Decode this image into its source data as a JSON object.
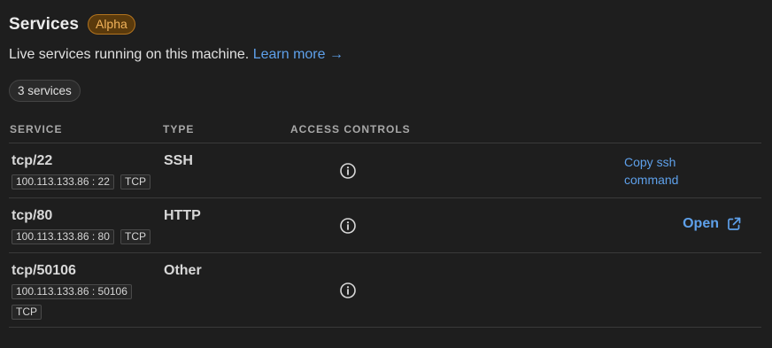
{
  "header": {
    "title": "Services",
    "badge": "Alpha",
    "subtitle": "Live services running on this machine.",
    "learn_more": "Learn more →",
    "count": "3 services"
  },
  "table": {
    "columns": [
      "SERVICE",
      "TYPE",
      "ACCESS CONTROLS"
    ],
    "rows": [
      {
        "service": "tcp/22",
        "type": "SSH",
        "address": "100.113.133.86 : 22",
        "protocol": "TCP",
        "action": "Copy ssh command",
        "action_line1": "Copy ssh",
        "action_line2": "command"
      },
      {
        "service": "tcp/80",
        "type": "HTTP",
        "address": "100.113.133.86 : 80",
        "protocol": "TCP",
        "action": "Open"
      },
      {
        "service": "tcp/50106",
        "type": "Other",
        "address": "100.113.133.86 : 50106",
        "protocol": "TCP"
      }
    ]
  },
  "colors": {
    "background": "#1e1e1e",
    "link": "#5ea0ea",
    "badge_bg": "#5a3a0c",
    "badge_text": "#f2b35a"
  },
  "icons": {
    "info": "info-circle-icon",
    "external": "external-link-icon"
  }
}
